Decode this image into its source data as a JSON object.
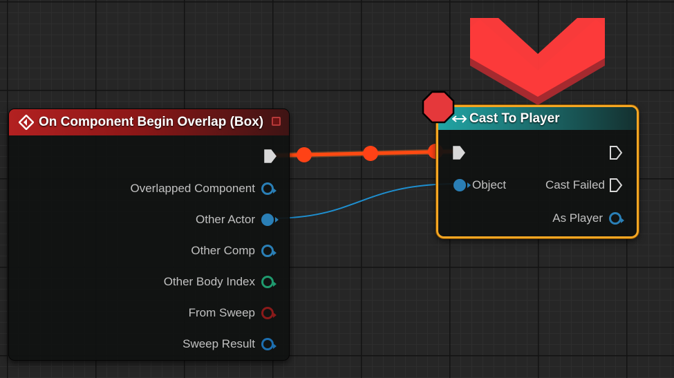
{
  "event_node": {
    "title": "On Component Begin Overlap (Box)",
    "outputs": [
      {
        "label": "Overlapped Component",
        "color": "#2a7fb6",
        "style": "hollow"
      },
      {
        "label": "Other Actor",
        "color": "#2a7fb6",
        "style": "filled"
      },
      {
        "label": "Other Comp",
        "color": "#2a7fb6",
        "style": "hollow"
      },
      {
        "label": "Other Body Index",
        "color": "#1f9a6e",
        "style": "hollow"
      },
      {
        "label": "From Sweep",
        "color": "#8a1a1a",
        "style": "hollow"
      },
      {
        "label": "Sweep Result",
        "color": "#1d6fb0",
        "style": "hollow"
      }
    ]
  },
  "cast_node": {
    "title": "Cast To Player",
    "input_object": "Object",
    "output_cast_failed": "Cast Failed",
    "output_as_player": "As Player"
  },
  "icons": {
    "event": "event-diamond-icon",
    "cast": "cast-arrows-icon",
    "breakpoint": "breakpoint-octagon-icon",
    "highlight": "downward-chevron-arrow-icon"
  },
  "colors": {
    "event_header": "#b32121",
    "cast_header": "#21a6a6",
    "exec_wire_active": "#ff4a12",
    "object_wire": "#1e8fd0",
    "selection_border": "#f5a623",
    "breakpoint": "#e5383b",
    "highlight_arrow": "#ff3b3b"
  }
}
